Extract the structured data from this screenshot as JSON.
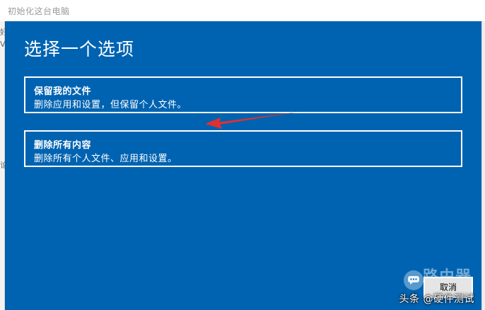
{
  "window": {
    "title": "初始化这台电脑"
  },
  "left_strip": {
    "marks": [
      "好",
      "V",
      "论"
    ]
  },
  "main": {
    "title": "选择一个选项",
    "options": [
      {
        "title": "保留我的文件",
        "description": "删除应用和设置，但保留个人文件。"
      },
      {
        "title": "删除所有内容",
        "description": "删除所有个人文件、应用和设置。"
      }
    ],
    "cancel_label": "取消"
  },
  "annotation": {
    "arrow_color": "#e0302f",
    "target": "option-keep-files"
  },
  "watermark": {
    "brand": "路由器",
    "tag": "头条 @硬件测试"
  },
  "colors": {
    "panel_bg": "#0063b1",
    "option_border": "#ffffff",
    "arrow": "#e0302f"
  },
  "icons": {
    "watermark_badge": "chat-bubble-icon"
  }
}
